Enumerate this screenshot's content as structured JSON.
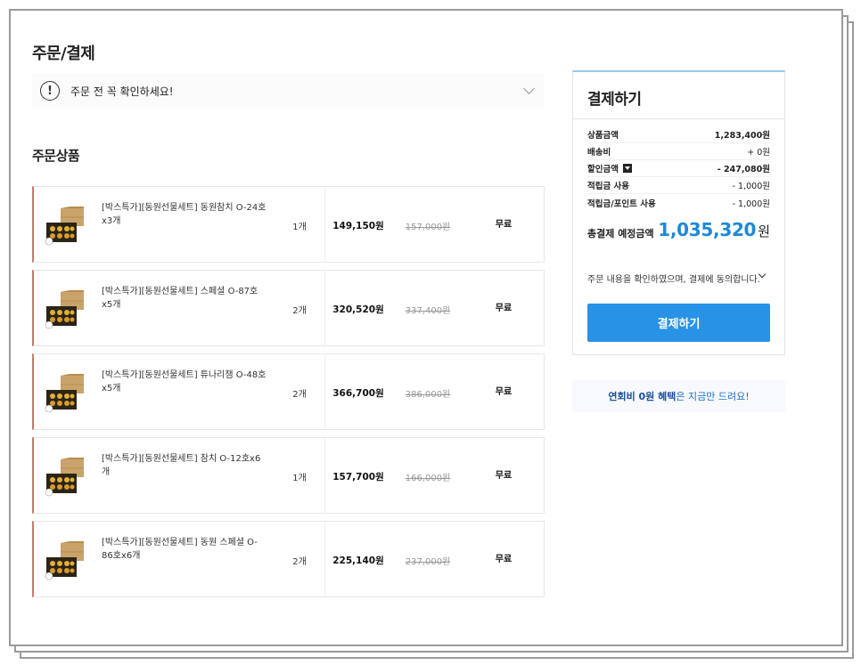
{
  "page": {
    "title": "주문/결제"
  },
  "notice": {
    "text": "주문 전 꼭 확인하세요!",
    "icon": "exclamation-circle-icon"
  },
  "order_section": {
    "title": "주문상품"
  },
  "items": [
    {
      "name": "[박스특가][동원선물세트] 동원참치 O-24호x3개",
      "qty": "1개",
      "price": "149,150원",
      "original_price": "157,000원",
      "shipping": "무료"
    },
    {
      "name": "[박스특가][동원선물세트] 스페셜 O-87호x5개",
      "qty": "2개",
      "price": "320,520원",
      "original_price": "337,400원",
      "shipping": "무료"
    },
    {
      "name": "[박스특가][동원선물세트] 튜나리챔 O-48호x5개",
      "qty": "2개",
      "price": "366,700원",
      "original_price": "386,000원",
      "shipping": "무료"
    },
    {
      "name": "[박스특가][동원선물세트] 참치 O-12호x6개",
      "qty": "1개",
      "price": "157,700원",
      "original_price": "166,000원",
      "shipping": "무료"
    },
    {
      "name": "[박스특가][동원선물세트] 동원 스페셜 O-86호x6개",
      "qty": "2개",
      "price": "225,140원",
      "original_price": "237,000원",
      "shipping": "무료"
    }
  ],
  "payment": {
    "title": "결제하기",
    "rows": [
      {
        "label": "상품금액",
        "value": "1,283,400원"
      },
      {
        "label": "배송비",
        "value": "+ 0원"
      },
      {
        "label": "할인금액",
        "value": "- 247,080원"
      },
      {
        "label": "적립금 사용",
        "value": "- 1,000원"
      },
      {
        "label": "적립금/포인트 사용",
        "value": "- 1,000원"
      }
    ],
    "total_label": "총결제 예정금액",
    "total_value": "1,035,320",
    "total_unit": "원",
    "agreement": "주문 내용을 확인하였으며, 결제에 동의합니다.",
    "button_label": "결제하기",
    "accent_color": "#2892e6"
  },
  "promo": {
    "part1": "연회비 0원 혜택",
    "part2": "은 지금만 드려요!"
  }
}
